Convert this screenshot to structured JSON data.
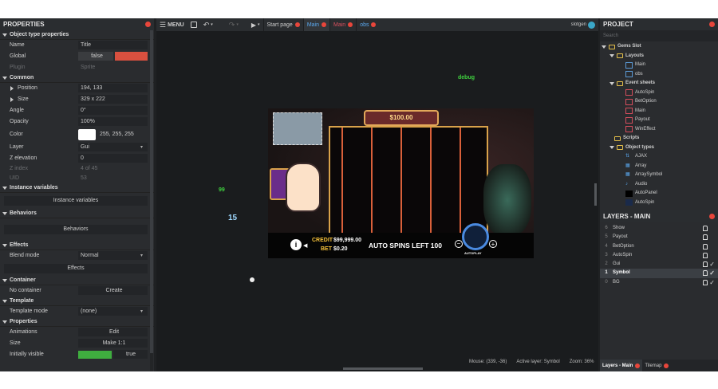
{
  "properties": {
    "title": "PROPERTIES",
    "sections": {
      "object_type": "Object type properties",
      "common": "Common",
      "instance_vars": "Instance variables",
      "behaviors": "Behaviors",
      "effects": "Effects",
      "container": "Container",
      "template": "Template",
      "props": "Properties"
    },
    "name_label": "Name",
    "name_value": "Title",
    "global_label": "Global",
    "global_value": "false",
    "plugin_label": "Plugin",
    "plugin_value": "Sprite",
    "position_label": "Position",
    "position_value": "194, 133",
    "size_label": "Size",
    "size_value": "329 x 222",
    "angle_label": "Angle",
    "angle_value": "0°",
    "opacity_label": "Opacity",
    "opacity_value": "100%",
    "color_label": "Color",
    "color_value": "255, 255, 255",
    "layer_label": "Layer",
    "layer_value": "Gui",
    "zelev_label": "Z elevation",
    "zelev_value": "0",
    "zindex_label": "Z index",
    "zindex_value": "4 of 45",
    "uid_label": "UID",
    "uid_value": "53",
    "instance_vars_button": "Instance variables",
    "behaviors_button": "Behaviors",
    "blend_label": "Blend mode",
    "blend_value": "Normal",
    "effects_button": "Effects",
    "no_container_label": "No container",
    "create_button": "Create",
    "template_mode_label": "Template mode",
    "template_mode_value": "(none)",
    "animations_label": "Animations",
    "edit_button": "Edit",
    "size2_label": "Size",
    "make11_button": "Make 1:1",
    "initially_visible_label": "Initially visible",
    "initially_visible_value": "true"
  },
  "toolbar": {
    "menu_label": "MENU",
    "tabs": [
      "Start page",
      "Main",
      "Main",
      "obs"
    ]
  },
  "canvas": {
    "debug_text": "debug",
    "num99": "99",
    "num15": "15",
    "game": {
      "top_amount": "$100.00",
      "credit_label": "CREDIT",
      "credit_value": "$99,999.00",
      "bet_label": "BET",
      "bet_value": "$0.20",
      "auto_spins_text": "AUTO SPINS LEFT 100",
      "autoplay_label": "AUTOPLAY"
    }
  },
  "status": {
    "mouse": "Mouse: (339, -36)",
    "active_layer": "Active layer: Symbol",
    "zoom": "Zoom: 36%"
  },
  "project": {
    "title": "PROJECT",
    "search_placeholder": "Search",
    "root": "Gems Slot",
    "layouts_folder": "Layouts",
    "layouts": [
      "Main",
      "obs"
    ],
    "eventsheets_folder": "Event sheets",
    "eventsheets": [
      "AutoSpin",
      "BetOption",
      "Main",
      "Payout",
      "WinEffect"
    ],
    "scripts_folder": "Scripts",
    "objecttypes_folder": "Object types",
    "objecttypes": [
      "AJAX",
      "Array",
      "ArraySymbol",
      "Audio",
      "AutoPanel",
      "AutoSpin"
    ]
  },
  "layers": {
    "title": "LAYERS - MAIN",
    "items": [
      {
        "num": "6",
        "name": "Show"
      },
      {
        "num": "5",
        "name": "Payout"
      },
      {
        "num": "4",
        "name": "BetOption"
      },
      {
        "num": "3",
        "name": "AutoSpin"
      },
      {
        "num": "2",
        "name": "Gui"
      },
      {
        "num": "1",
        "name": "Symbol"
      },
      {
        "num": "0",
        "name": "BG"
      }
    ],
    "bottom_tabs": [
      "Layers - Main",
      "Tilemap"
    ]
  },
  "colors": {
    "accent_red": "#e8463b",
    "green": "#3fd13f",
    "false_red": "#d9503f"
  }
}
